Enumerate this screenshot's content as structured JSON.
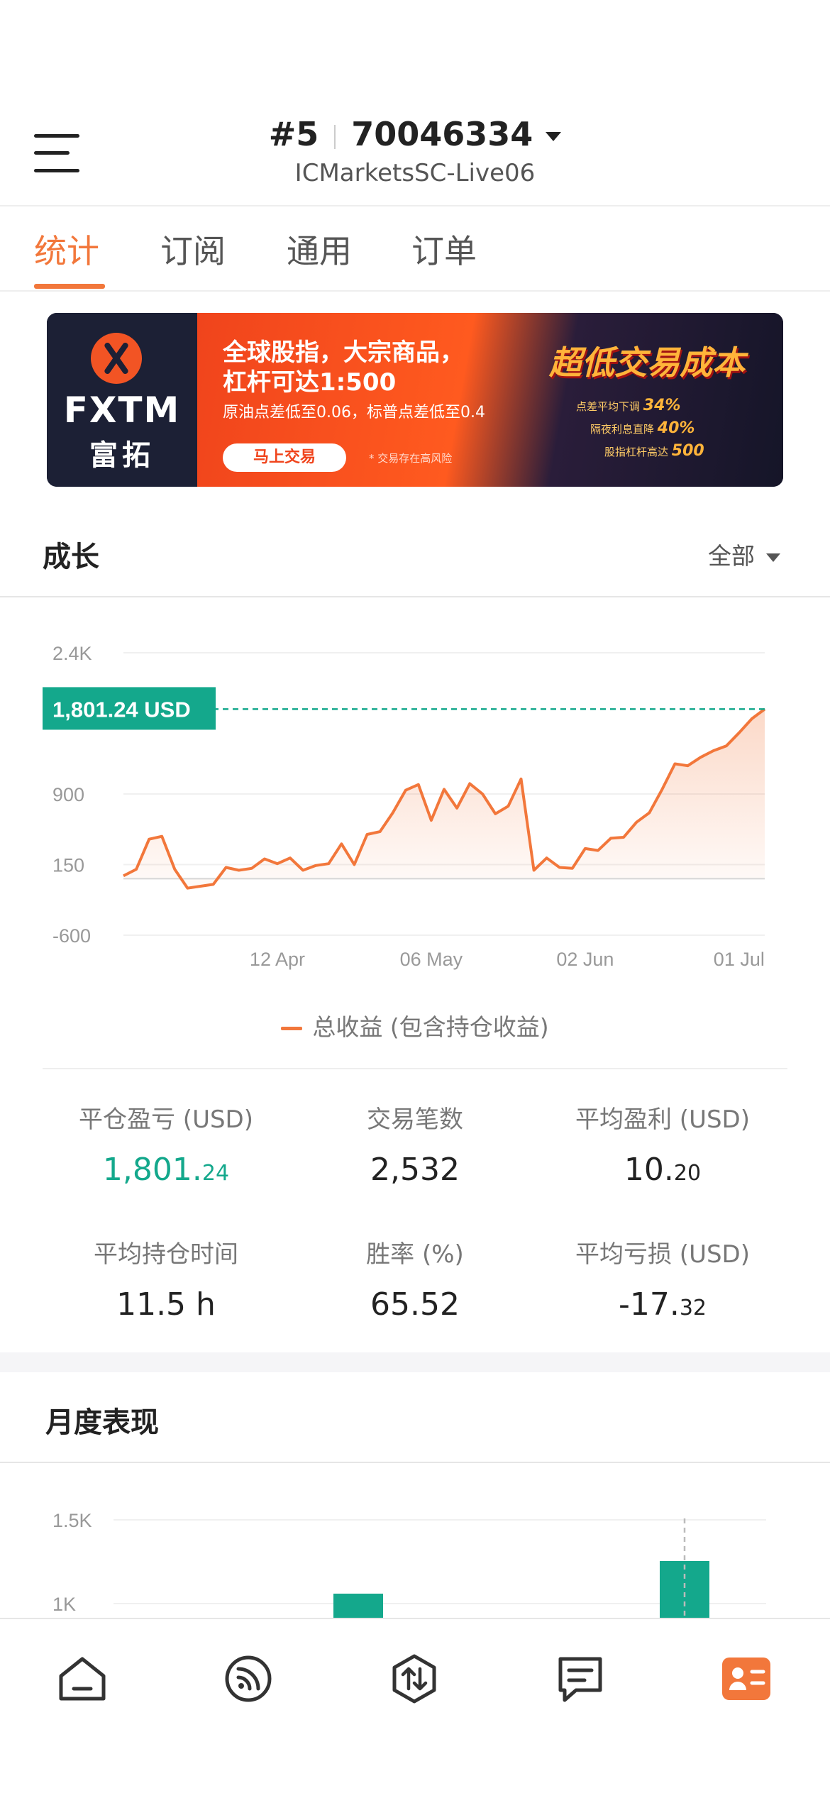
{
  "header": {
    "account_index": "#5",
    "account_number": "70046334",
    "server": "ICMarketsSC-Live06"
  },
  "tabs": [
    {
      "label": "统计",
      "active": true
    },
    {
      "label": "订阅",
      "active": false
    },
    {
      "label": "通用",
      "active": false
    },
    {
      "label": "订单",
      "active": false
    }
  ],
  "banner": {
    "brand_name": "FXTM",
    "brand_sub": "富拓",
    "headline_1": "全球股指，大宗商品，",
    "headline_2": "杠杆可达1:500",
    "subline": "原油点差低至0.06，标普点差低至0.4",
    "button_label": "马上交易",
    "risk_note": "* 交易存在高风险",
    "big_slogan": "超低交易成本",
    "line_1": "点差平均下调",
    "line_1_value": "34%",
    "line_2": "隔夜利息直降",
    "line_2_value": "40%",
    "line_3": "股指杠杆高达",
    "line_3_value": "500"
  },
  "growth": {
    "title": "成长",
    "range_label": "全部",
    "current_label": "1,801.24 USD",
    "legend": "总收益 (包含持仓收益)"
  },
  "chart_data": {
    "type": "area",
    "series": [
      {
        "name": "总收益 (包含持仓收益)",
        "x": [
          0,
          2,
          4,
          6,
          8,
          10,
          12,
          14,
          16,
          18,
          20,
          22,
          24,
          26,
          28,
          30,
          32,
          34,
          36,
          38,
          40,
          42,
          44,
          46,
          48,
          50,
          52,
          54,
          56,
          58,
          60,
          62,
          64,
          66,
          68,
          70,
          72,
          74,
          76,
          78,
          80,
          82,
          84,
          86,
          88,
          90,
          92,
          94,
          96,
          98,
          100
        ],
        "values": [
          30,
          100,
          420,
          450,
          100,
          -100,
          -80,
          -60,
          120,
          90,
          110,
          210,
          160,
          220,
          90,
          140,
          160,
          370,
          150,
          470,
          500,
          700,
          940,
          1000,
          620,
          950,
          750,
          1010,
          900,
          690,
          770,
          1060,
          90,
          220,
          120,
          110,
          320,
          300,
          430,
          440,
          600,
          700,
          950,
          1220,
          1200,
          1290,
          1360,
          1410,
          1550,
          1700,
          1801.24
        ]
      }
    ],
    "x_tick_labels": [
      "12 Apr",
      "06 May",
      "02 Jun",
      "01 Jul"
    ],
    "x_tick_positions": [
      24,
      48,
      72,
      96
    ],
    "y_tick_labels": [
      "2.4K",
      "900",
      "150",
      "-600"
    ],
    "y_ticks": [
      2400,
      900,
      150,
      -600
    ],
    "ylim": [
      -600,
      2400
    ],
    "grid": true,
    "current_value": 1801.24,
    "line_color": "#f2773b",
    "marker_color": "#14a88c"
  },
  "stats": {
    "closed_pl": {
      "label": "平仓盈亏 (USD)",
      "int": "1,801.",
      "frac": "24"
    },
    "trades": {
      "label": "交易笔数",
      "value": "2,532"
    },
    "avg_profit": {
      "label": "平均盈利 (USD)",
      "int": "10.",
      "frac": "20"
    },
    "avg_hold": {
      "label": "平均持仓时间",
      "value": "11.5 h"
    },
    "win_rate": {
      "label": "胜率 (%)",
      "value": "65.52"
    },
    "avg_loss": {
      "label": "平均亏损 (USD)",
      "int": "-17.",
      "frac": "32"
    }
  },
  "monthly": {
    "title": "月度表现",
    "y_tick_labels": [
      "1.5K",
      "1K"
    ]
  },
  "monthly_chart_data": {
    "type": "bar",
    "visible_bars": [
      {
        "name": "bar-a",
        "value": 1000
      },
      {
        "name": "bar-b",
        "value": 1100
      }
    ],
    "y_ticks": [
      1500,
      1000
    ],
    "bar_color": "#14a88c"
  },
  "bottom_nav": [
    {
      "name": "home"
    },
    {
      "name": "signals"
    },
    {
      "name": "trade"
    },
    {
      "name": "messages"
    },
    {
      "name": "profile",
      "active": true
    }
  ],
  "colors": {
    "accent": "#f2773b",
    "positive": "#14a88c"
  }
}
